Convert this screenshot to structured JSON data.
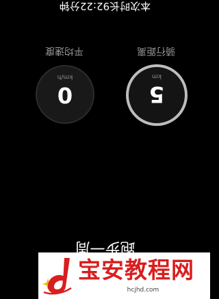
{
  "screen": {
    "orientation": "rotated-180",
    "header": "本次时长92:22分钟",
    "bottom_label": "跑步一周",
    "background_color": "#000000"
  },
  "metrics": [
    {
      "label": "平均速度",
      "unit": "km/h",
      "value": "0"
    },
    {
      "label": "骑行距离",
      "unit": "km",
      "value": "5"
    }
  ],
  "watermark": {
    "title": "宝安教程网",
    "url": "hcjhd.com",
    "brand_color": "#d81e1e",
    "logo_icon": "d-logo-icon"
  }
}
